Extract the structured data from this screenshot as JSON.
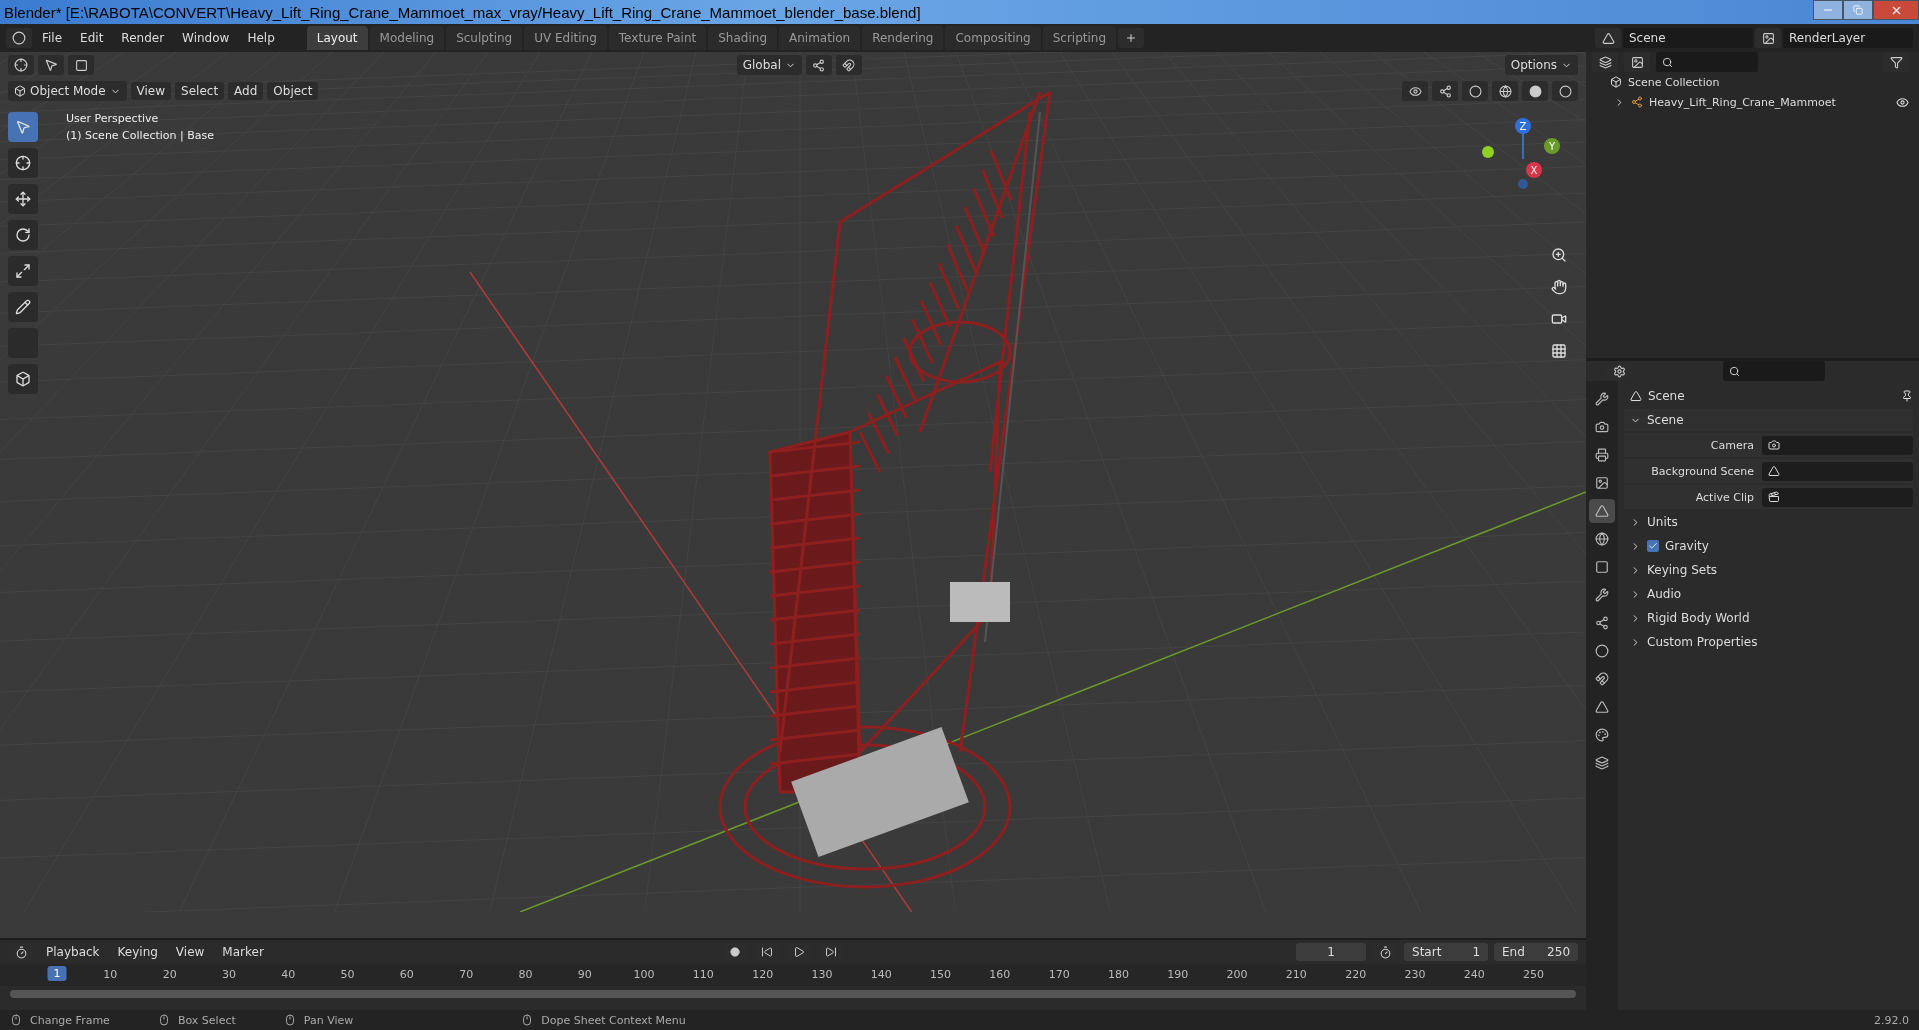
{
  "window": {
    "title": "Blender* [E:\\RABOTA\\CONVERT\\Heavy_Lift_Ring_Crane_Mammoet_max_vray/Heavy_Lift_Ring_Crane_Mammoet_blender_base.blend]"
  },
  "menu": [
    "File",
    "Edit",
    "Render",
    "Window",
    "Help"
  ],
  "workspaces": [
    {
      "label": "Layout",
      "selected": true
    },
    {
      "label": "Modeling",
      "selected": false
    },
    {
      "label": "Sculpting",
      "selected": false
    },
    {
      "label": "UV Editing",
      "selected": false
    },
    {
      "label": "Texture Paint",
      "selected": false
    },
    {
      "label": "Shading",
      "selected": false
    },
    {
      "label": "Animation",
      "selected": false
    },
    {
      "label": "Rendering",
      "selected": false
    },
    {
      "label": "Compositing",
      "selected": false
    },
    {
      "label": "Scripting",
      "selected": false
    }
  ],
  "scene": "Scene",
  "view_layer": "RenderLayer",
  "viewport": {
    "mode": "Object Mode",
    "menus": [
      "View",
      "Select",
      "Add",
      "Object"
    ],
    "orientation": "Global",
    "options": "Options",
    "info": [
      "User Perspective",
      "(1) Scene Collection | Base"
    ],
    "axes": [
      "Z",
      "Y",
      "X"
    ]
  },
  "outliner": {
    "root": "Scene Collection",
    "children": [
      {
        "label": "Heavy_Lift_Ring_Crane_Mammoet",
        "expanded": false
      }
    ]
  },
  "properties": {
    "title": "Scene",
    "tabs": [
      {
        "kind": "tool",
        "selected": false
      },
      {
        "kind": "render",
        "selected": false
      },
      {
        "kind": "output",
        "selected": false
      },
      {
        "kind": "view-layer",
        "selected": false
      },
      {
        "kind": "scene",
        "selected": true
      },
      {
        "kind": "world",
        "selected": false
      },
      {
        "kind": "object",
        "selected": false
      },
      {
        "kind": "modifier",
        "selected": false
      },
      {
        "kind": "particles",
        "selected": false
      },
      {
        "kind": "physics",
        "selected": false
      },
      {
        "kind": "constraint",
        "selected": false
      },
      {
        "kind": "data",
        "selected": false
      },
      {
        "kind": "material",
        "selected": false
      },
      {
        "kind": "texture",
        "selected": false
      }
    ],
    "panels": [
      {
        "label": "Scene",
        "expanded": true,
        "fields": [
          "Camera",
          "Background Scene",
          "Active Clip"
        ]
      },
      {
        "label": "Units",
        "expanded": false
      },
      {
        "label": "Gravity",
        "expanded": false,
        "checked": true
      },
      {
        "label": "Keying Sets",
        "expanded": false
      },
      {
        "label": "Audio",
        "expanded": false
      },
      {
        "label": "Rigid Body World",
        "expanded": false
      },
      {
        "label": "Custom Properties",
        "expanded": false
      }
    ]
  },
  "timeline": {
    "menus": [
      "Playback",
      "Keying",
      "View",
      "Marker"
    ],
    "current_frame": "1",
    "start_label": "Start",
    "start": "1",
    "end_label": "End",
    "end": "250",
    "playhead": "1",
    "ticks": [
      "10",
      "20",
      "30",
      "40",
      "50",
      "60",
      "70",
      "80",
      "90",
      "100",
      "110",
      "120",
      "130",
      "140",
      "150",
      "160",
      "170",
      "180",
      "190",
      "200",
      "210",
      "220",
      "230",
      "240",
      "250"
    ]
  },
  "status_bar": {
    "hints": [
      "Change Frame",
      "Box Select",
      "Pan View",
      "Dope Sheet Context Menu"
    ],
    "version": "2.92.0"
  }
}
